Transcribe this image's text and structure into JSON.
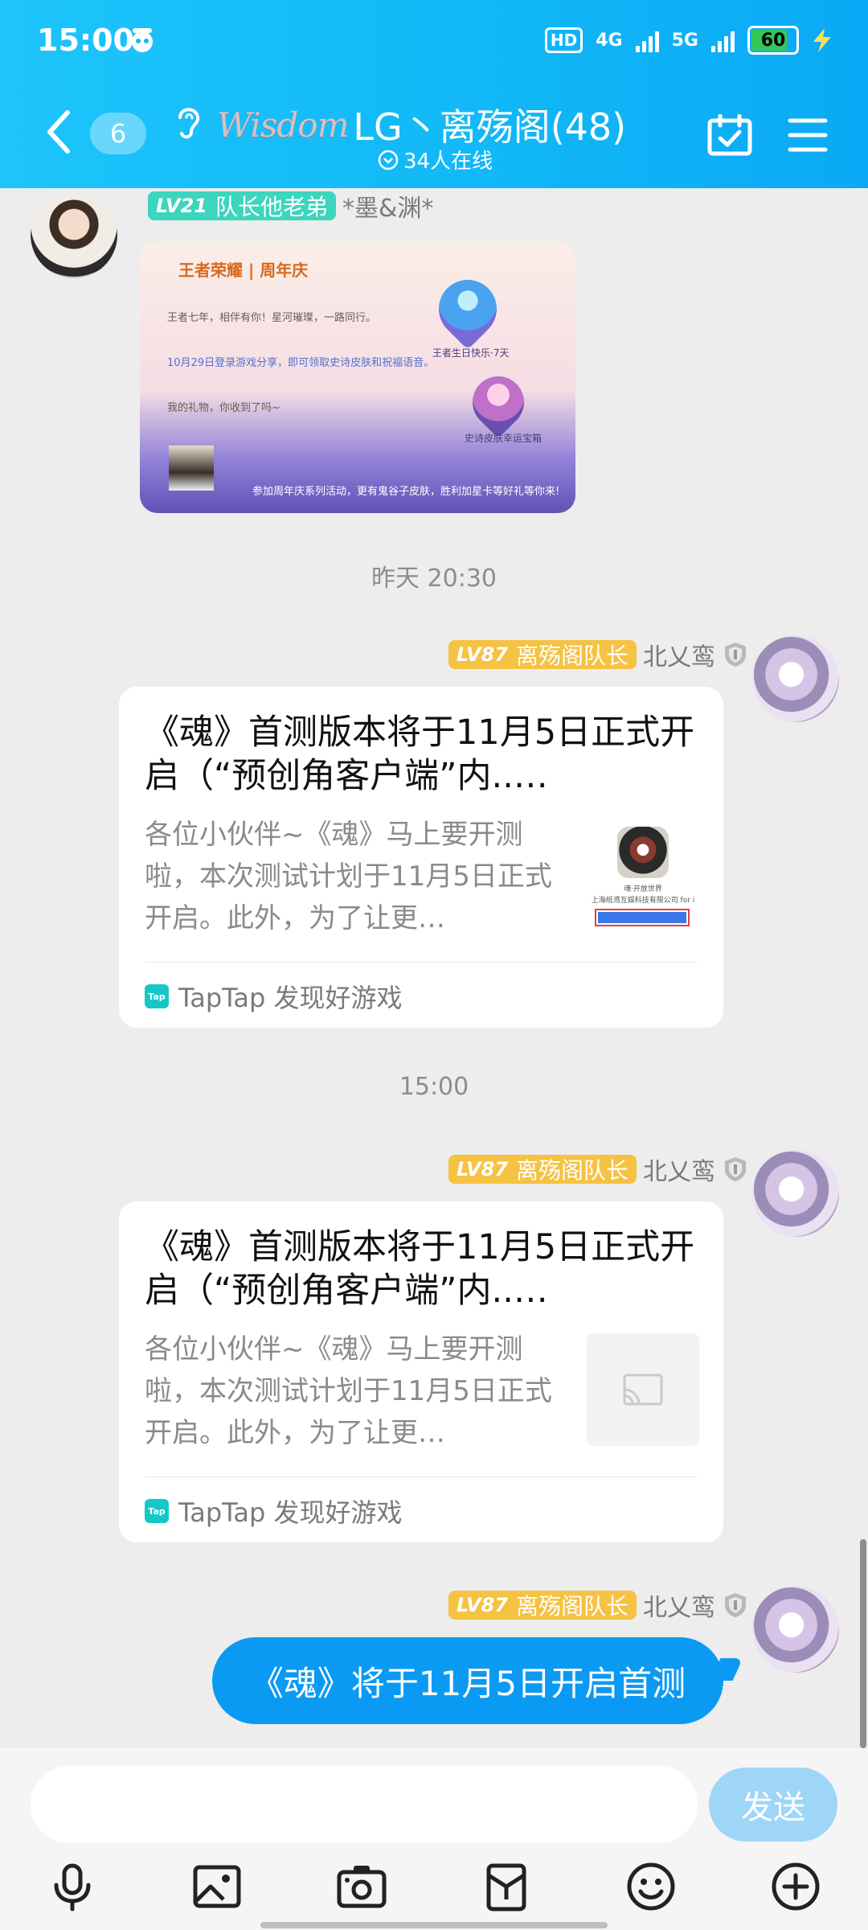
{
  "status_bar": {
    "time": "15:00",
    "hd_label": "HD",
    "net_1": "4G",
    "net_2": "5G",
    "battery": "60"
  },
  "header": {
    "back_count": "6",
    "group_prefix": "Wisdom",
    "group_name": "LG丶离殇阁(48)",
    "online": "34人在线"
  },
  "chat": {
    "msg1": {
      "level": "LV21",
      "badge": "队长他老弟",
      "sender": "*墨&渊*"
    },
    "image_card": {
      "logo": "王者荣耀 | 周年庆",
      "line1": "王者七年，相伴有你！星河璀璨，一路同行。",
      "line2": "10月29日登录游戏分享，即可领取史诗皮肤和祝福语音。",
      "line3": "我的礼物，你收到了吗~",
      "label1": "王者生日快乐·7天",
      "label2": "史诗皮肤幸运宝箱",
      "bottom": "参加周年庆系列活动，更有鬼谷子皮肤，胜利加星卡等好礼等你来!"
    },
    "divider1": "昨天 20:30",
    "msg2": {
      "level": "LV87",
      "badge": "离殇阁队长",
      "sender": "北乂鸾",
      "title": "《魂》首测版本将于11月5日正式开启（“预创角客户端”内..…",
      "desc": "各位小伙伴~《魂》马上要开测啦，本次测试计划于11月5日正式开启。此外，为了让更…",
      "thumb_line1": "魂·开放世界",
      "thumb_line2": "上海纸鸢互娱科技有限公司 for i",
      "source": "TapTap 发现好游戏"
    },
    "divider2": "15:00",
    "msg3": {
      "level": "LV87",
      "badge": "离殇阁队长",
      "sender": "北乂鸾",
      "title": "《魂》首测版本将于11月5日正式开启（“预创角客户端”内..…",
      "desc": "各位小伙伴~《魂》马上要开测啦，本次测试计划于11月5日正式开启。此外，为了让更…",
      "source": "TapTap 发现好游戏"
    },
    "msg4": {
      "level": "LV87",
      "badge": "离殇阁队长",
      "sender": "北乂鸾",
      "text": "《魂》将于11月5日开启首测"
    }
  },
  "input": {
    "placeholder": "",
    "send_label": "发送"
  },
  "toolbar": [
    "microphone-icon",
    "image-icon",
    "camera-icon",
    "red-packet-icon",
    "emoji-icon",
    "plus-icon"
  ],
  "colors": {
    "header": "#12b8f7",
    "bubble": "#0b9af3",
    "badge_gold": "#f5c242",
    "badge_teal": "#3cd5bd",
    "send": "#9fd6f8"
  }
}
